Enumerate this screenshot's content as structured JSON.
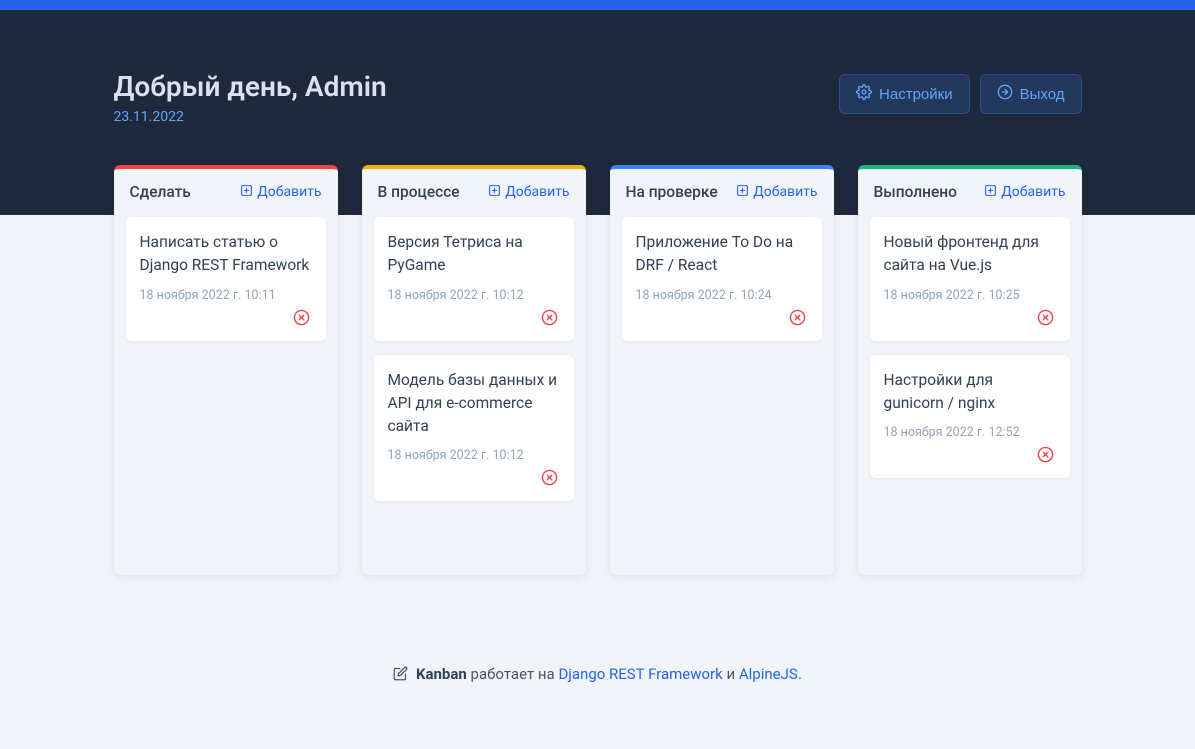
{
  "header": {
    "greeting": "Добрый день, Admin",
    "date": "23.11.2022",
    "settings_label": "Настройки",
    "logout_label": "Выход"
  },
  "board": {
    "add_label": "Добавить",
    "columns": [
      {
        "id": "todo",
        "title": "Сделать",
        "color": "red",
        "cards": [
          {
            "title": "Написать статью о Django REST Framework",
            "timestamp": "18 ноября 2022 г. 10:11"
          }
        ]
      },
      {
        "id": "in_progress",
        "title": "В процессе",
        "color": "yellow",
        "cards": [
          {
            "title": "Версия Тетриса на PyGame",
            "timestamp": "18 ноября 2022 г. 10:12"
          },
          {
            "title": "Модель базы данных и API для e-commerce сайта",
            "timestamp": "18 ноября 2022 г. 10:12"
          }
        ]
      },
      {
        "id": "review",
        "title": "На проверке",
        "color": "blue",
        "cards": [
          {
            "title": "Приложение To Do на DRF / React",
            "timestamp": "18 ноября 2022 г. 10:24"
          }
        ]
      },
      {
        "id": "done",
        "title": "Выполнено",
        "color": "green",
        "cards": [
          {
            "title": "Новый фронтенд для сайта на Vue.js",
            "timestamp": "18 ноября 2022 г. 10:25"
          },
          {
            "title": "Настройки для gunicorn / nginx",
            "timestamp": "18 ноября 2022 г. 12:52"
          }
        ]
      }
    ]
  },
  "footer": {
    "brand": "Kanban",
    "text_runs_on": "работает на",
    "link1": "Django REST Framework",
    "and": "и",
    "link2": "AlpineJS",
    "period": "."
  }
}
